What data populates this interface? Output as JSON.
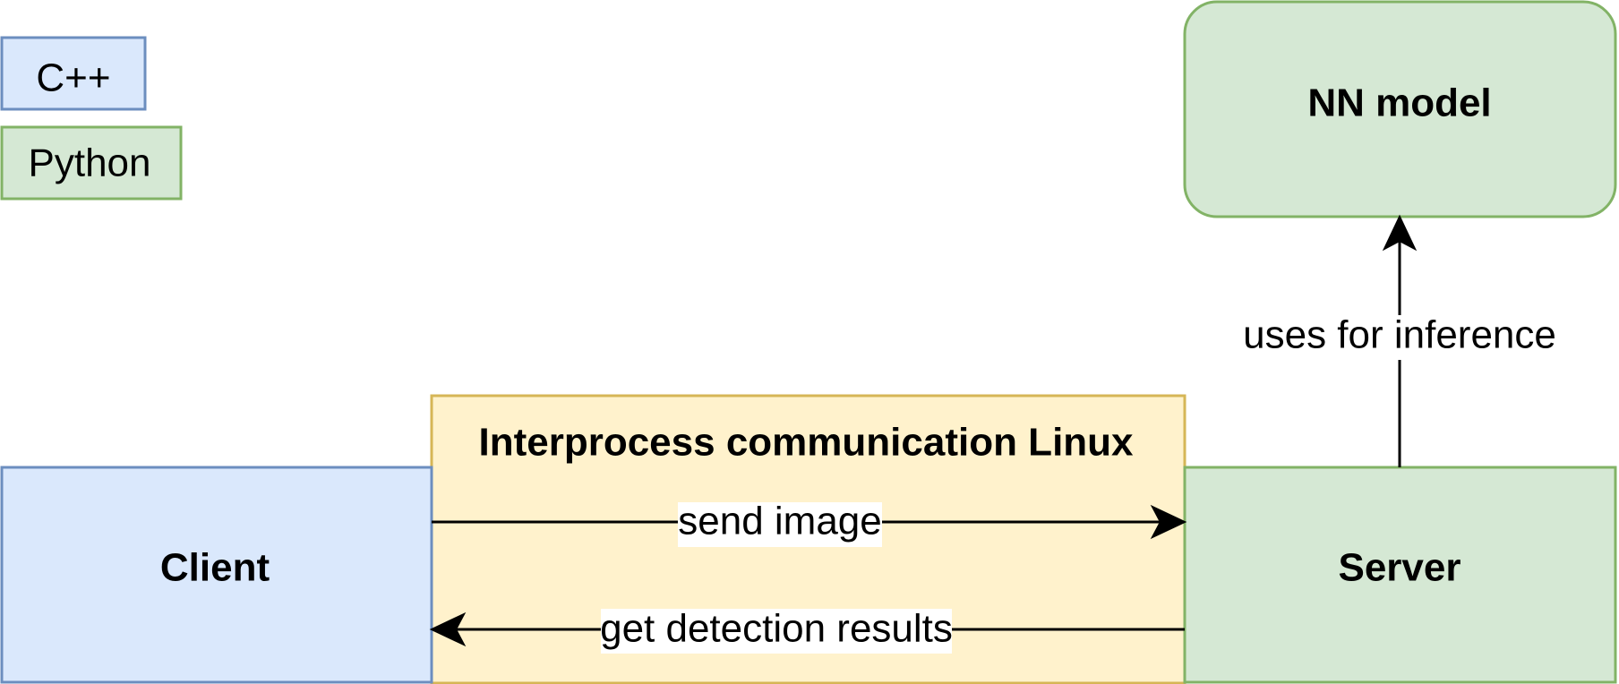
{
  "legend": {
    "cpp": {
      "label": "C++",
      "fill": "#dae8fc",
      "stroke": "#6c8ebf"
    },
    "python": {
      "label": "Python",
      "fill": "#d5e8d4",
      "stroke": "#82b366"
    }
  },
  "nodes": {
    "nn_model": {
      "label": "NN model",
      "fill": "#d5e8d4",
      "stroke": "#82b366"
    },
    "ipc": {
      "label": "Interprocess communication Linux",
      "fill": "#fff2cc",
      "stroke": "#d6b656"
    },
    "client": {
      "label": "Client",
      "fill": "#dae8fc",
      "stroke": "#6c8ebf"
    },
    "server": {
      "label": "Server",
      "fill": "#d5e8d4",
      "stroke": "#82b366"
    }
  },
  "edges": {
    "send_image": {
      "label": "send image",
      "from": "Client",
      "to": "Server"
    },
    "get_results": {
      "label": "get detection results",
      "from": "Server",
      "to": "Client"
    },
    "uses_inference": {
      "label": "uses for inference",
      "from": "Server",
      "to": "NN model"
    }
  }
}
